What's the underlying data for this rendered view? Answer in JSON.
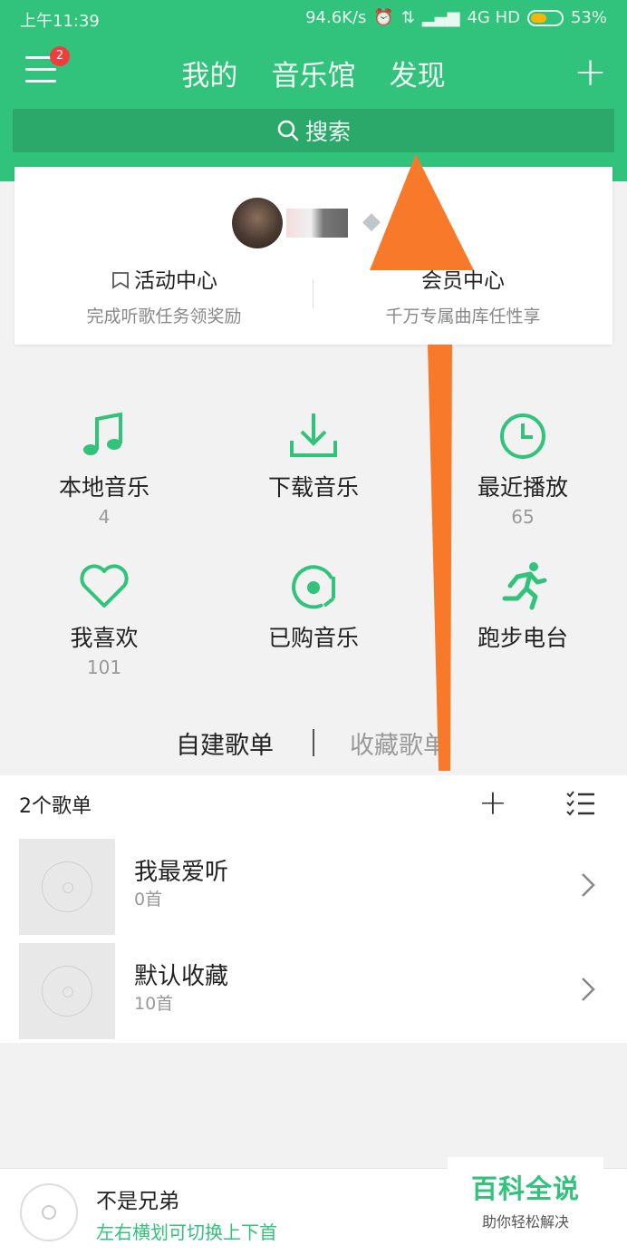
{
  "status_bar": {
    "time": "上午11:39",
    "network_speed": "94.6K/s",
    "signal": "4G HD",
    "battery": "53%",
    "battery_level": 0.53
  },
  "header": {
    "menu_badge": "2",
    "tabs": [
      "我的",
      "音乐馆",
      "发现"
    ],
    "plus": "+",
    "search_label": "搜索",
    "accent_color": "#31c27c"
  },
  "profile_card": {
    "activity": {
      "title": "活动中心",
      "subtitle": "完成听歌任务领奖励"
    },
    "vip": {
      "title": "会员中心",
      "subtitle": "千万专属曲库任性享"
    }
  },
  "quick_grid": [
    {
      "label": "本地音乐",
      "count": "4",
      "icon": "music-note-icon"
    },
    {
      "label": "下载音乐",
      "count": "",
      "icon": "download-icon"
    },
    {
      "label": "最近播放",
      "count": "65",
      "icon": "clock-icon"
    },
    {
      "label": "我喜欢",
      "count": "101",
      "icon": "heart-icon"
    },
    {
      "label": "已购音乐",
      "count": "",
      "icon": "purchased-disc-icon"
    },
    {
      "label": "跑步电台",
      "count": "",
      "icon": "running-icon"
    }
  ],
  "playlist_tabs": {
    "created": "自建歌单",
    "favorited": "收藏歌单"
  },
  "playlists": {
    "count_label": "2个歌单",
    "items": [
      {
        "name": "我最爱听",
        "count": "0首"
      },
      {
        "name": "默认收藏",
        "count": "10首"
      }
    ]
  },
  "player": {
    "song": "不是兄弟",
    "hint": "左右横划可切换上下首"
  },
  "watermark": {
    "title": "百科全说",
    "subtitle": "助你轻松解决"
  }
}
